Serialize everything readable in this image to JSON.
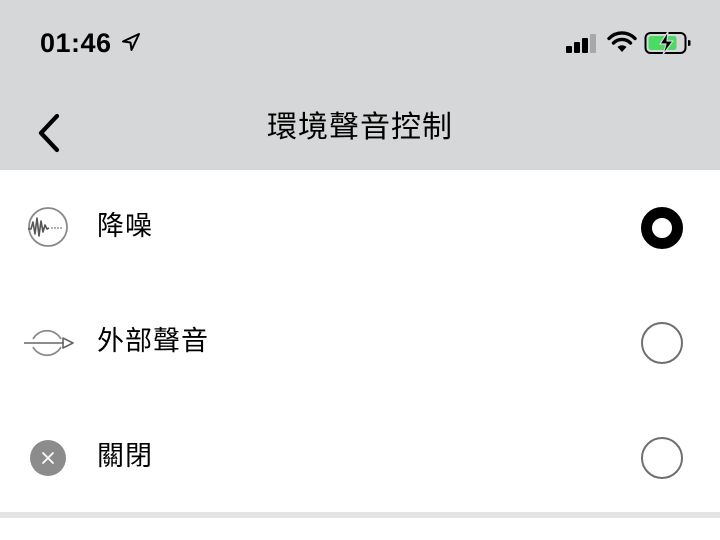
{
  "status_bar": {
    "time": "01:46",
    "icons": [
      "location-arrow-icon",
      "cellular-signal-icon",
      "wifi-icon",
      "battery-charging-icon"
    ]
  },
  "nav": {
    "back_icon": "chevron-left-icon",
    "title": "環境聲音控制"
  },
  "options": [
    {
      "label": "降噪",
      "icon": "noise-cancelling-icon",
      "selected": true
    },
    {
      "label": "外部聲音",
      "icon": "ambient-sound-icon",
      "selected": false
    },
    {
      "label": "關閉",
      "icon": "off-icon",
      "selected": false
    }
  ],
  "colors": {
    "header_background": "#d6d7d8",
    "battery_fill": "#4cd964",
    "radio_selected": "#000000",
    "radio_unselected_border": "#6f6f6f",
    "off_icon_fill": "#8c8c8c"
  }
}
